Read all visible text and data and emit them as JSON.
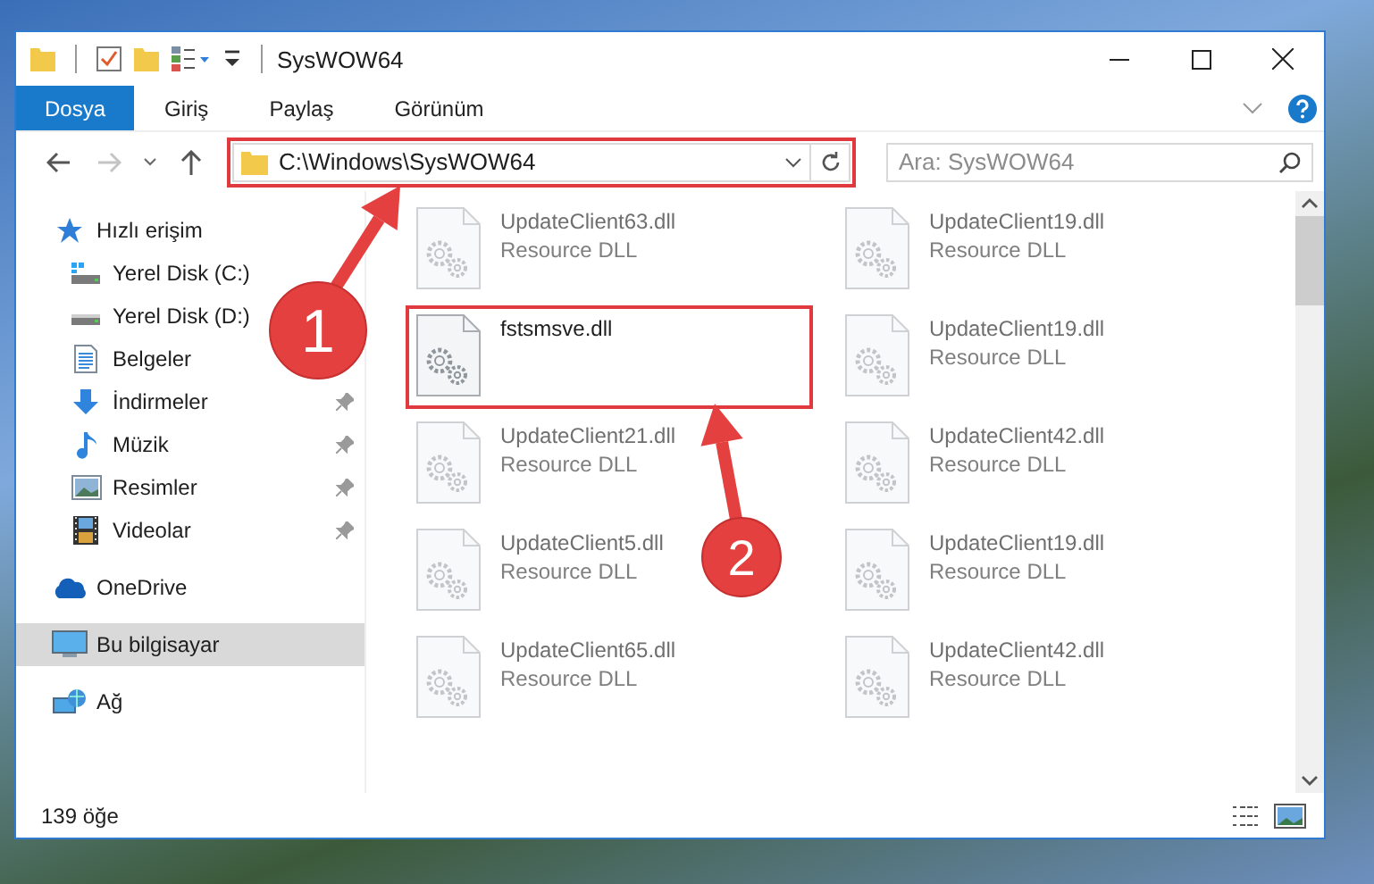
{
  "window": {
    "title": "SysWOW64"
  },
  "ribbon_tabs": [
    {
      "label": "Dosya",
      "selected": true
    },
    {
      "label": "Giriş",
      "selected": false
    },
    {
      "label": "Paylaş",
      "selected": false
    },
    {
      "label": "Görünüm",
      "selected": false
    }
  ],
  "address_bar": {
    "path": "C:\\Windows\\SysWOW64",
    "outlined": true
  },
  "search": {
    "placeholder": "Ara: SysWOW64"
  },
  "sidebar": {
    "items": [
      {
        "label": "Hızlı erişim",
        "kind": "star",
        "selected": false,
        "pinned": false,
        "children": [
          {
            "label": "Yerel Disk (C:)",
            "kind": "system-drive",
            "selected": false,
            "pinned": false
          },
          {
            "label": "Yerel Disk (D:)",
            "kind": "drive",
            "selected": false,
            "pinned": false
          },
          {
            "label": "Belgeler",
            "kind": "documents",
            "selected": false,
            "pinned": false
          },
          {
            "label": "İndirmeler",
            "kind": "download",
            "selected": false,
            "pinned": true
          },
          {
            "label": "Müzik",
            "kind": "music",
            "selected": false,
            "pinned": true
          },
          {
            "label": "Resimler",
            "kind": "pictures",
            "selected": false,
            "pinned": true
          },
          {
            "label": "Videolar",
            "kind": "videos",
            "selected": false,
            "pinned": true
          }
        ]
      },
      {
        "label": "OneDrive",
        "kind": "cloud",
        "selected": false,
        "pinned": false
      },
      {
        "label": "Bu bilgisayar",
        "kind": "computer",
        "selected": true,
        "pinned": false
      },
      {
        "label": "Ağ",
        "kind": "network",
        "selected": false,
        "pinned": false
      }
    ]
  },
  "files": [
    {
      "name": "UpdateClient63.dll",
      "type": "Resource DLL",
      "blurred": true,
      "outlined": false
    },
    {
      "name": "UpdateClient19.dll",
      "type": "Resource DLL",
      "blurred": true,
      "outlined": false
    },
    {
      "name": "fstsmsve.dll",
      "blurred": false,
      "outlined": true
    },
    {
      "name": "UpdateClient19.dll",
      "type": "Resource DLL",
      "blurred": true,
      "outlined": false
    },
    {
      "name": "UpdateClient21.dll",
      "type": "Resource DLL",
      "blurred": true,
      "outlined": false
    },
    {
      "name": "UpdateClient42.dll",
      "type": "Resource DLL",
      "blurred": true,
      "outlined": false
    },
    {
      "name": "UpdateClient5.dll",
      "type": "Resource DLL",
      "blurred": true,
      "outlined": false
    },
    {
      "name": "UpdateClient19.dll",
      "type": "Resource DLL",
      "blurred": true,
      "outlined": false
    },
    {
      "name": "UpdateClient65.dll",
      "type": "Resource DLL",
      "blurred": true,
      "outlined": false
    },
    {
      "name": "UpdateClient42.dll",
      "type": "Resource DLL",
      "blurred": true,
      "outlined": false
    }
  ],
  "status_bar": {
    "count": "139 öğe"
  },
  "callouts": [
    {
      "label": "1"
    },
    {
      "label": "2"
    }
  ]
}
